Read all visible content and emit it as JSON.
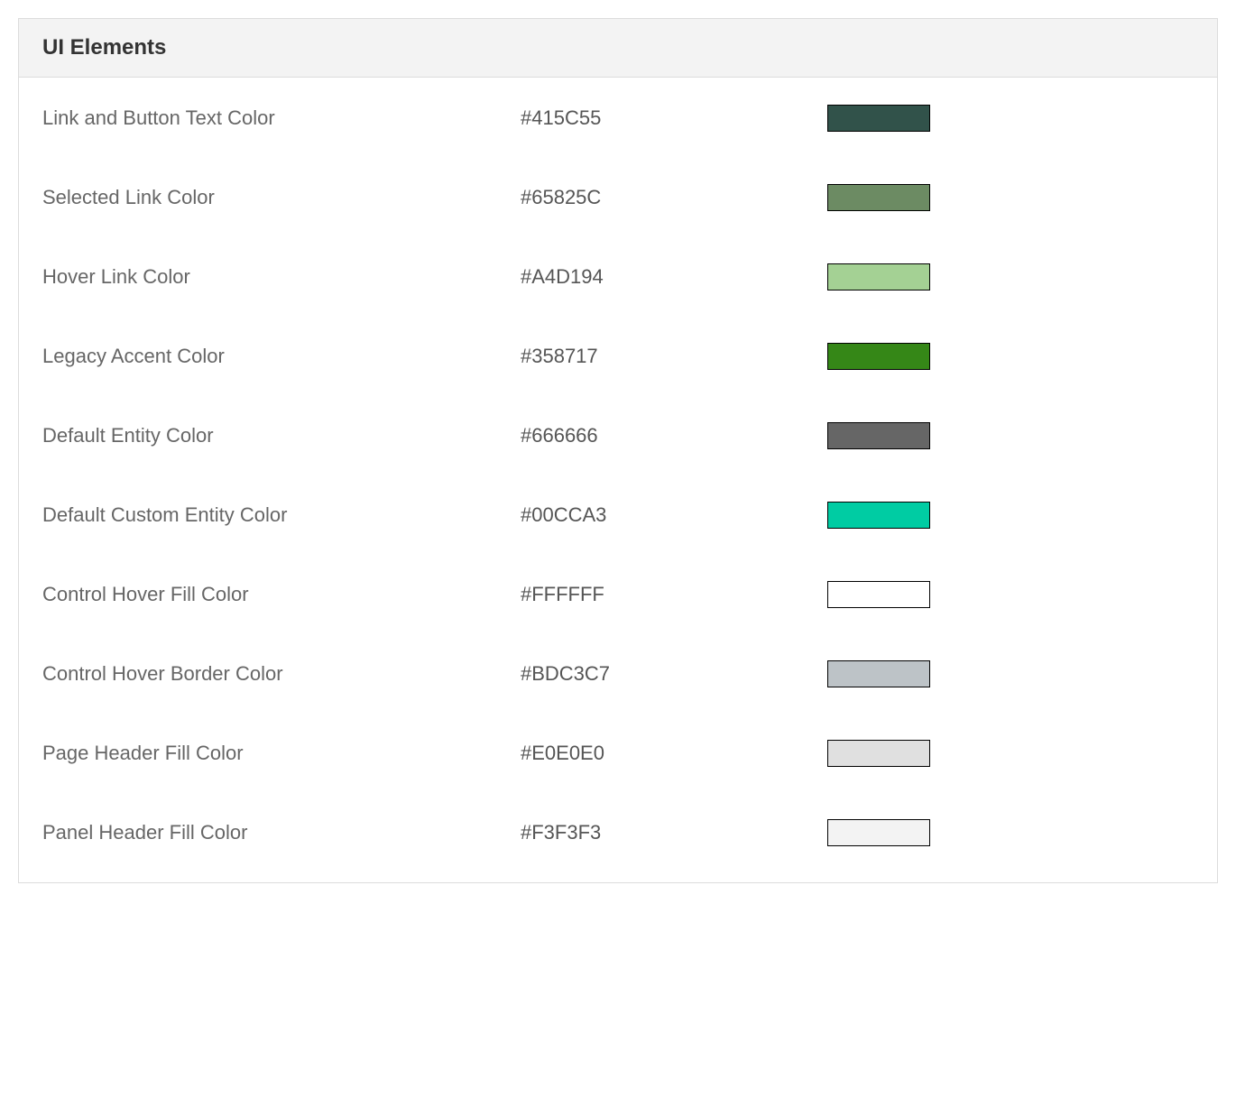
{
  "panel": {
    "title": "UI Elements",
    "rows": [
      {
        "label": "Link and Button Text Color",
        "value": "#415C55",
        "swatch": "#31524A"
      },
      {
        "label": "Selected Link Color",
        "value": "#65825C",
        "swatch": "#6C8B63"
      },
      {
        "label": "Hover Link Color",
        "value": "#A4D194",
        "swatch": "#A4D194"
      },
      {
        "label": "Legacy Accent Color",
        "value": "#358717",
        "swatch": "#358717"
      },
      {
        "label": "Default Entity Color",
        "value": "#666666",
        "swatch": "#666666"
      },
      {
        "label": "Default Custom Entity Color",
        "value": "#00CCA3",
        "swatch": "#00CCA3"
      },
      {
        "label": "Control Hover Fill Color",
        "value": "#FFFFFF",
        "swatch": "#FFFFFF"
      },
      {
        "label": "Control Hover Border Color",
        "value": "#BDC3C7",
        "swatch": "#BDC3C7"
      },
      {
        "label": "Page Header Fill Color",
        "value": "#E0E0E0",
        "swatch": "#E0E0E0"
      },
      {
        "label": "Panel Header Fill Color",
        "value": "#F3F3F3",
        "swatch": "#F3F3F3"
      }
    ]
  }
}
